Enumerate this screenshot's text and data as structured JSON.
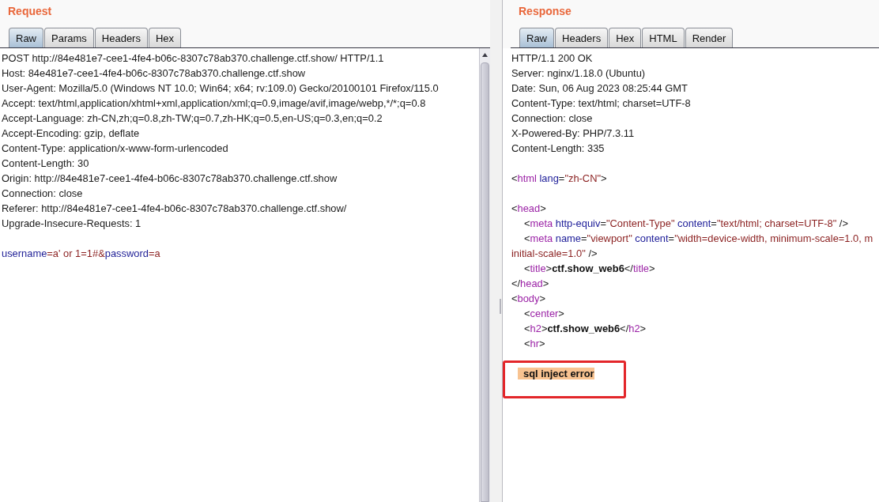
{
  "request": {
    "title": "Request",
    "tabs": [
      {
        "label": "Raw",
        "selected": true
      },
      {
        "label": "Params",
        "selected": false
      },
      {
        "label": "Headers",
        "selected": false
      },
      {
        "label": "Hex",
        "selected": false
      }
    ],
    "lines": [
      {
        "kind": "plain",
        "text": "POST http://84e481e7-cee1-4fe4-b06c-8307c78ab370.challenge.ctf.show/ HTTP/1.1"
      },
      {
        "kind": "plain",
        "text": "Host: 84e481e7-cee1-4fe4-b06c-8307c78ab370.challenge.ctf.show"
      },
      {
        "kind": "plain",
        "text": "User-Agent: Mozilla/5.0 (Windows NT 10.0; Win64; x64; rv:109.0) Gecko/20100101 Firefox/115.0"
      },
      {
        "kind": "plain",
        "text": "Accept: text/html,application/xhtml+xml,application/xml;q=0.9,image/avif,image/webp,*/*;q=0.8"
      },
      {
        "kind": "plain",
        "text": "Accept-Language: zh-CN,zh;q=0.8,zh-TW;q=0.7,zh-HK;q=0.5,en-US;q=0.3,en;q=0.2"
      },
      {
        "kind": "plain",
        "text": "Accept-Encoding: gzip, deflate"
      },
      {
        "kind": "plain",
        "text": "Content-Type: application/x-www-form-urlencoded"
      },
      {
        "kind": "plain",
        "text": "Content-Length: 30"
      },
      {
        "kind": "plain",
        "text": "Origin: http://84e481e7-cee1-4fe4-b06c-8307c78ab370.challenge.ctf.show"
      },
      {
        "kind": "plain",
        "text": "Connection: close"
      },
      {
        "kind": "plain",
        "text": "Referer: http://84e481e7-cee1-4fe4-b06c-8307c78ab370.challenge.ctf.show/"
      },
      {
        "kind": "plain",
        "text": "Upgrade-Insecure-Requests: 1"
      },
      {
        "kind": "blank"
      },
      {
        "kind": "code",
        "segments": [
          {
            "kind": "name",
            "text": "username"
          },
          {
            "kind": "value",
            "text": "=a' or 1=1#&"
          },
          {
            "kind": "name",
            "text": "password"
          },
          {
            "kind": "value",
            "text": "=a"
          }
        ]
      }
    ]
  },
  "response": {
    "title": "Response",
    "tabs": [
      {
        "label": "Raw",
        "selected": true
      },
      {
        "label": "Headers",
        "selected": false
      },
      {
        "label": "Hex",
        "selected": false
      },
      {
        "label": "HTML",
        "selected": false
      },
      {
        "label": "Render",
        "selected": false
      }
    ],
    "lines": [
      {
        "kind": "plain",
        "text": "HTTP/1.1 200 OK"
      },
      {
        "kind": "plain",
        "text": "Server: nginx/1.18.0 (Ubuntu)"
      },
      {
        "kind": "plain",
        "text": "Date: Sun, 06 Aug 2023 08:25:44 GMT"
      },
      {
        "kind": "plain",
        "text": "Content-Type: text/html; charset=UTF-8"
      },
      {
        "kind": "plain",
        "text": "Connection: close"
      },
      {
        "kind": "plain",
        "text": "X-Powered-By: PHP/7.3.11"
      },
      {
        "kind": "plain",
        "text": "Content-Length: 335"
      },
      {
        "kind": "blank"
      },
      {
        "kind": "code",
        "segments": [
          {
            "kind": "punct",
            "text": "<"
          },
          {
            "kind": "tag",
            "text": "html"
          },
          {
            "kind": "attr",
            "text": " lang"
          },
          {
            "kind": "punct",
            "text": "="
          },
          {
            "kind": "value",
            "text": "\"zh-CN\""
          },
          {
            "kind": "punct",
            "text": ">"
          }
        ]
      },
      {
        "kind": "blank"
      },
      {
        "kind": "code",
        "segments": [
          {
            "kind": "punct",
            "text": "<"
          },
          {
            "kind": "tag",
            "text": "head"
          },
          {
            "kind": "punct",
            "text": ">"
          }
        ],
        "children": [
          {
            "kind": "code",
            "segments": [
              {
                "kind": "punct",
                "text": "<"
              },
              {
                "kind": "tag",
                "text": "meta"
              },
              {
                "kind": "attr",
                "text": " http-equiv"
              },
              {
                "kind": "punct",
                "text": "="
              },
              {
                "kind": "value",
                "text": "\"Content-Type\""
              },
              {
                "kind": "attr",
                "text": " content"
              },
              {
                "kind": "punct",
                "text": "="
              },
              {
                "kind": "value",
                "text": "\"text/html; charset=UTF-8\""
              },
              {
                "kind": "punct",
                "text": " />"
              }
            ]
          },
          {
            "kind": "code",
            "segments": [
              {
                "kind": "punct",
                "text": "<"
              },
              {
                "kind": "tag",
                "text": "meta"
              },
              {
                "kind": "attr",
                "text": " name"
              },
              {
                "kind": "punct",
                "text": "="
              },
              {
                "kind": "value",
                "text": "\"viewport\""
              },
              {
                "kind": "attr",
                "text": " content"
              },
              {
                "kind": "punct",
                "text": "="
              },
              {
                "kind": "value",
                "text": "\"width=device-width, minimum-scale=1.0, m"
              }
            ],
            "wrap": [
              {
                "kind": "value",
                "text": "initial-scale=1.0\""
              },
              {
                "kind": "punct",
                "text": " />"
              }
            ]
          },
          {
            "kind": "code",
            "segments": [
              {
                "kind": "punct",
                "text": "<"
              },
              {
                "kind": "tag",
                "text": "title"
              },
              {
                "kind": "punct",
                "text": ">"
              },
              {
                "kind": "bold",
                "text": "ctf.show_web6"
              },
              {
                "kind": "punct",
                "text": "</"
              },
              {
                "kind": "tag",
                "text": "title"
              },
              {
                "kind": "punct",
                "text": ">"
              }
            ]
          }
        ]
      },
      {
        "kind": "code",
        "segments": [
          {
            "kind": "punct",
            "text": "</"
          },
          {
            "kind": "tag",
            "text": "head"
          },
          {
            "kind": "punct",
            "text": ">"
          }
        ]
      },
      {
        "kind": "code",
        "segments": [
          {
            "kind": "punct",
            "text": "<"
          },
          {
            "kind": "tag",
            "text": "body"
          },
          {
            "kind": "punct",
            "text": ">"
          }
        ],
        "children": [
          {
            "kind": "code",
            "segments": [
              {
                "kind": "punct",
                "text": "<"
              },
              {
                "kind": "tag",
                "text": "center"
              },
              {
                "kind": "punct",
                "text": ">"
              }
            ]
          },
          {
            "kind": "code",
            "segments": [
              {
                "kind": "punct",
                "text": "<"
              },
              {
                "kind": "tag",
                "text": "h2"
              },
              {
                "kind": "punct",
                "text": ">"
              },
              {
                "kind": "bold",
                "text": "ctf.show_web6"
              },
              {
                "kind": "punct",
                "text": "</"
              },
              {
                "kind": "tag",
                "text": "h2"
              },
              {
                "kind": "punct",
                "text": ">"
              }
            ]
          },
          {
            "kind": "code",
            "segments": [
              {
                "kind": "punct",
                "text": "<"
              },
              {
                "kind": "tag",
                "text": "hr"
              },
              {
                "kind": "punct",
                "text": ">"
              }
            ]
          },
          {
            "kind": "blank"
          },
          {
            "kind": "boxed",
            "segments": [
              {
                "kind": "match",
                "text": "sql inject error"
              }
            ]
          }
        ]
      }
    ]
  }
}
